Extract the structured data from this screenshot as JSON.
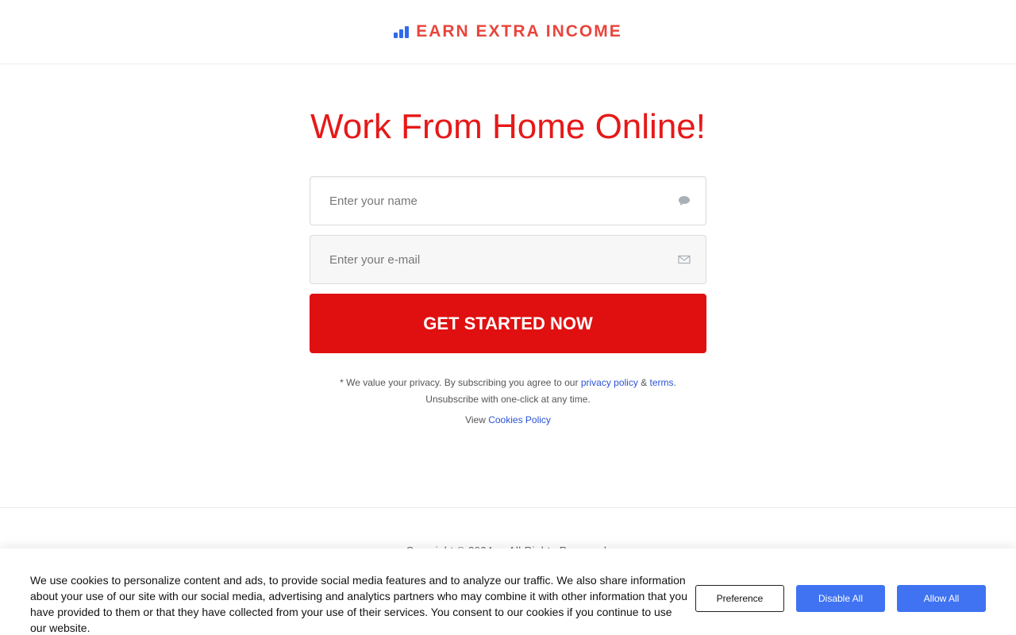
{
  "header": {
    "logo_icon": "bar-chart-icon",
    "logo_text": "EARN EXTRA INCOME"
  },
  "main": {
    "headline": "Work From Home Online!",
    "name_placeholder": "Enter your name",
    "name_icon": "chat-bubble-icon",
    "email_placeholder": "Enter your e-mail",
    "email_icon": "envelope-icon",
    "cta_label": "GET STARTED NOW",
    "privacy": {
      "prefix": "* We value your privacy.  By subscribing you agree to our",
      "policy_link": "privacy policy",
      "and": "&",
      "terms_link": "terms",
      "suffix": ".",
      "line2": "Unsubscribe with one-click at any time."
    },
    "cookies": {
      "prefix": "View",
      "link": "Cookies Policy"
    }
  },
  "footer": {
    "copyright": "Copyright © 2024 ... All Rights Reserved."
  },
  "cookie_banner": {
    "text": "We use cookies to personalize content and ads, to provide social media features and to analyze our traffic. We also share information about your use of our site with our social media, advertising and analytics partners who may combine it with other information that you have provided to them or that they have collected from your use of their services. You consent to our cookies if you continue to use our website.",
    "preference_label": "Preference",
    "disable_label": "Disable All",
    "allow_label": "Allow All"
  },
  "colors": {
    "brand_red": "#e61919",
    "logo_text": "#e8453c",
    "logo_icon": "#2f6bea",
    "cta_bg": "#e01010",
    "link": "#2a52d6",
    "cookie_button": "#3f73f2"
  }
}
